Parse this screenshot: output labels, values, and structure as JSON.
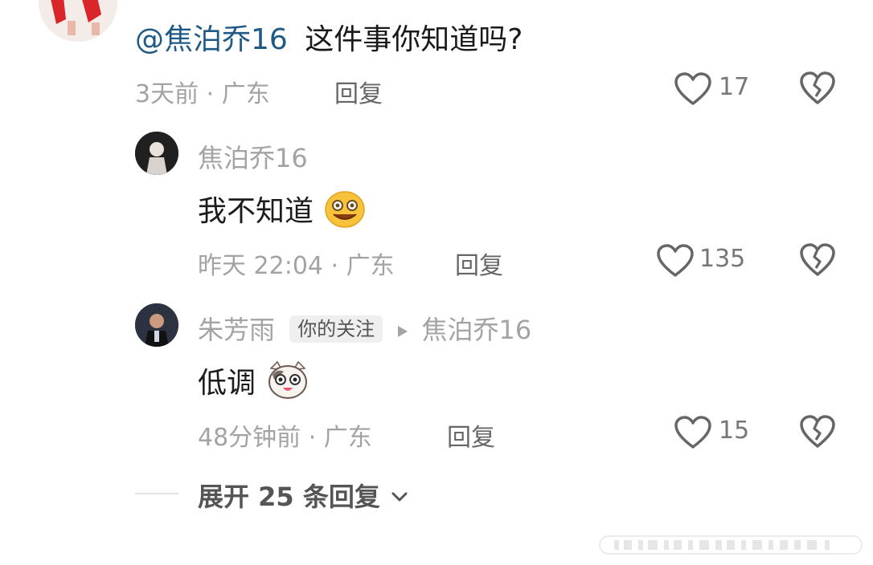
{
  "top_comment": {
    "mention": "@焦泊乔16",
    "text": "这件事你知道吗?",
    "meta": "3天前 · 广东",
    "reply_label": "回复",
    "likes": "17"
  },
  "replies": [
    {
      "username": "焦泊乔16",
      "text": "我不知道",
      "emoji": "laughing-face-emoji",
      "meta": "昨天 22:04 · 广东",
      "reply_label": "回复",
      "likes": "135"
    },
    {
      "username": "朱芳雨",
      "badge": "你的关注",
      "reply_to": "焦泊乔16",
      "text": "低调",
      "emoji": "cat-face-emoji",
      "meta": "48分钟前 · 广东",
      "reply_label": "回复",
      "likes": "15"
    }
  ],
  "expand": {
    "label": "展开 25 条回复"
  },
  "colors": {
    "mention": "#1f5a86",
    "muted": "#a3a3a3",
    "text": "#1c1c1c"
  }
}
